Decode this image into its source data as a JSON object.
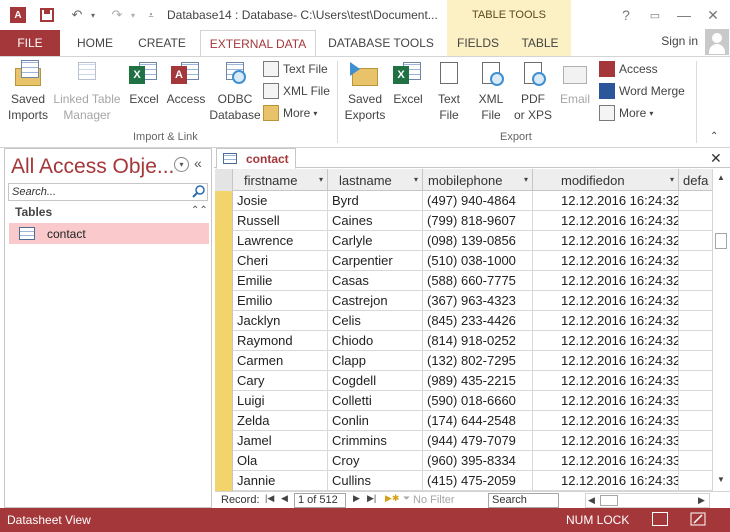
{
  "titlebar": {
    "title": "Database14 : Database- C:\\Users\\test\\Document...",
    "table_tools": "TABLE TOOLS",
    "help": "?",
    "minimize": "—",
    "maximize": "☐",
    "close": "✕"
  },
  "tabs": {
    "file": "FILE",
    "home": "HOME",
    "create": "CREATE",
    "external_data": "EXTERNAL DATA",
    "database_tools": "DATABASE TOOLS",
    "fields": "FIELDS",
    "table": "TABLE",
    "signin": "Sign in"
  },
  "ribbon": {
    "import": {
      "saved_imports": [
        "Saved",
        "Imports"
      ],
      "linked_table_manager": [
        "Linked Table",
        "Manager"
      ],
      "excel": "Excel",
      "access": "Access",
      "odbc": [
        "ODBC",
        "Database"
      ],
      "text_file": "Text File",
      "xml_file": "XML File",
      "more": "More",
      "group_label": "Import & Link"
    },
    "export": {
      "saved_exports": [
        "Saved",
        "Exports"
      ],
      "excel": "Excel",
      "text_file": [
        "Text",
        "File"
      ],
      "xml_file": [
        "XML",
        "File"
      ],
      "pdf": [
        "PDF",
        "or XPS"
      ],
      "email": "Email",
      "access": "Access",
      "word_merge": "Word Merge",
      "more": "More",
      "group_label": "Export"
    }
  },
  "nav": {
    "title": "All Access Obje...",
    "search_placeholder": "Search...",
    "section": "Tables",
    "items": [
      {
        "label": "contact"
      }
    ]
  },
  "document": {
    "tab_label": "contact",
    "close": "✕",
    "columns": [
      "firstname",
      "lastname",
      "mobilephone",
      "modifiedon",
      "defa"
    ],
    "rows": [
      [
        "Josie",
        "Byrd",
        "(497) 940-4864",
        "12.12.2016 16:24:32"
      ],
      [
        "Russell",
        "Caines",
        "(799) 818-9607",
        "12.12.2016 16:24:32"
      ],
      [
        "Lawrence",
        "Carlyle",
        "(098) 139-0856",
        "12.12.2016 16:24:32"
      ],
      [
        "Cheri",
        "Carpentier",
        "(510) 038-1000",
        "12.12.2016 16:24:32"
      ],
      [
        "Emilie",
        "Casas",
        "(588) 660-7775",
        "12.12.2016 16:24:32"
      ],
      [
        "Emilio",
        "Castrejon",
        "(367) 963-4323",
        "12.12.2016 16:24:32"
      ],
      [
        "Jacklyn",
        "Celis",
        "(845) 233-4426",
        "12.12.2016 16:24:32"
      ],
      [
        "Raymond",
        "Chiodo",
        "(814) 918-0252",
        "12.12.2016 16:24:32"
      ],
      [
        "Carmen",
        "Clapp",
        "(132) 802-7295",
        "12.12.2016 16:24:32"
      ],
      [
        "Cary",
        "Cogdell",
        "(989) 435-2215",
        "12.12.2016 16:24:33"
      ],
      [
        "Luigi",
        "Colletti",
        "(590) 018-6660",
        "12.12.2016 16:24:33"
      ],
      [
        "Zelda",
        "Conlin",
        "(174) 644-2548",
        "12.12.2016 16:24:33"
      ],
      [
        "Jamel",
        "Crimmins",
        "(944) 479-7079",
        "12.12.2016 16:24:33"
      ],
      [
        "Ola",
        "Croy",
        "(960) 395-8334",
        "12.12.2016 16:24:33"
      ],
      [
        "Jannie",
        "Cullins",
        "(415) 475-2059",
        "12.12.2016 16:24:33"
      ]
    ]
  },
  "recnav": {
    "label": "Record:",
    "position": "1 of 512",
    "no_filter": "No Filter",
    "search": "Search"
  },
  "status": {
    "mode": "Datasheet View",
    "numlock": "NUM LOCK"
  },
  "colors": {
    "accent": "#a4373a",
    "contextual": "#fcf1c4",
    "selected_nav": "#f9c9cb",
    "row_selector": "#f3d46b"
  }
}
